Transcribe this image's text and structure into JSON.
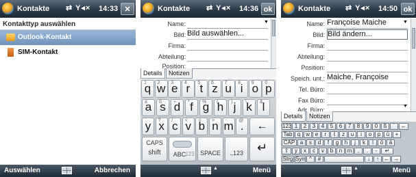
{
  "screens": [
    {
      "title": "Kontakte",
      "time": "14:33",
      "title_button": "✕",
      "heading": "Kontakttyp auswählen",
      "items": [
        "Outlook-Kontakt",
        "SIM-Kontakt"
      ],
      "softkey_left": "Auswählen",
      "softkey_right": "Abbrechen"
    },
    {
      "title": "Kontakte",
      "time": "14:36",
      "title_button": "ok",
      "fields": [
        {
          "label": "Name:",
          "value": ""
        },
        {
          "label": "Bild:",
          "value": "Bild auswählen..."
        },
        {
          "label": "Firma:",
          "value": ""
        },
        {
          "label": "Abteilung:",
          "value": ""
        },
        {
          "label": "Position:",
          "value": ""
        }
      ],
      "tabs": [
        "Details",
        "Notizen"
      ],
      "keyboard": {
        "row1": [
          [
            "1",
            "q"
          ],
          [
            "2",
            "w"
          ],
          [
            "3",
            "e"
          ],
          [
            "4",
            "r"
          ],
          [
            "5",
            "t"
          ],
          [
            "6",
            "z"
          ],
          [
            "7",
            "u"
          ],
          [
            "8",
            "i"
          ],
          [
            "9",
            "o"
          ],
          [
            "0",
            "p"
          ]
        ],
        "row2": [
          [
            "à",
            "a"
          ],
          [
            "ß",
            "s"
          ],
          [
            "+",
            "d"
          ],
          [
            "*",
            "f"
          ],
          [
            "%",
            "g"
          ],
          [
            "(",
            "h"
          ],
          [
            ")",
            "j"
          ],
          [
            "\\",
            "k"
          ],
          [
            "&",
            "l"
          ]
        ],
        "row3": [
          [
            "`",
            "y"
          ],
          [
            "?",
            "x"
          ],
          [
            "/",
            "c"
          ],
          [
            "<",
            "v"
          ],
          [
            "=",
            "b"
          ],
          [
            ">",
            "n"
          ],
          [
            "-",
            "m"
          ],
          [
            "@",
            "."
          ]
        ],
        "caps": "CAPS",
        "shift": "shift",
        "abc": "ABC",
        "num": "123",
        "space": "SPACE",
        "num_key": ".,123",
        "backspace": "←",
        "enter": "↵"
      },
      "softkey_right": "Menü"
    },
    {
      "title": "Kontakte",
      "time": "14:50",
      "title_button": "ok",
      "fields": [
        {
          "label": "Name:",
          "value": "Françoise Maiche"
        },
        {
          "label": "Bild:",
          "value": "Bild ändern..."
        },
        {
          "label": "Firma:",
          "value": ""
        },
        {
          "label": "Abteilung:",
          "value": ""
        },
        {
          "label": "Position:",
          "value": ""
        },
        {
          "label": "Speich. unt.:",
          "value": "Maiche, Françoise"
        },
        {
          "label": "Tel. Büro:",
          "value": ""
        },
        {
          "label": "Fax Büro:",
          "value": ""
        },
        {
          "label": "Adr. Büro:",
          "value": ""
        }
      ],
      "tabs": [
        "Details",
        "Notizen"
      ],
      "keyboard": {
        "row1": [
          "123",
          "1",
          "2",
          "3",
          "4",
          "5",
          "6",
          "7",
          "8",
          "9",
          "0",
          "ß",
          "´",
          "←"
        ],
        "row2": [
          "Tab",
          "q",
          "w",
          "e",
          "r",
          "t",
          "z",
          "u",
          "i",
          "o",
          "p",
          "ü",
          "+"
        ],
        "row3": [
          "CAP",
          "a",
          "s",
          "d",
          "f",
          "g",
          "h",
          "j",
          "k",
          "l",
          "ö",
          "ä"
        ],
        "row4": [
          "⇧",
          "y",
          "x",
          "c",
          "v",
          "b",
          "n",
          "m",
          ",",
          ".",
          "-",
          "↵"
        ],
        "row5": [
          "Strg",
          "Sym",
          "^",
          "#",
          "",
          "↓",
          "↑",
          "←",
          "→"
        ]
      },
      "softkey_right": "Menü"
    }
  ],
  "status_icons": "⇄ Y◂× ",
  "colors": {
    "titlebar": "#2b3a48",
    "selection": "#7a9cc2",
    "keyboard_bg": "#c9ced3"
  }
}
